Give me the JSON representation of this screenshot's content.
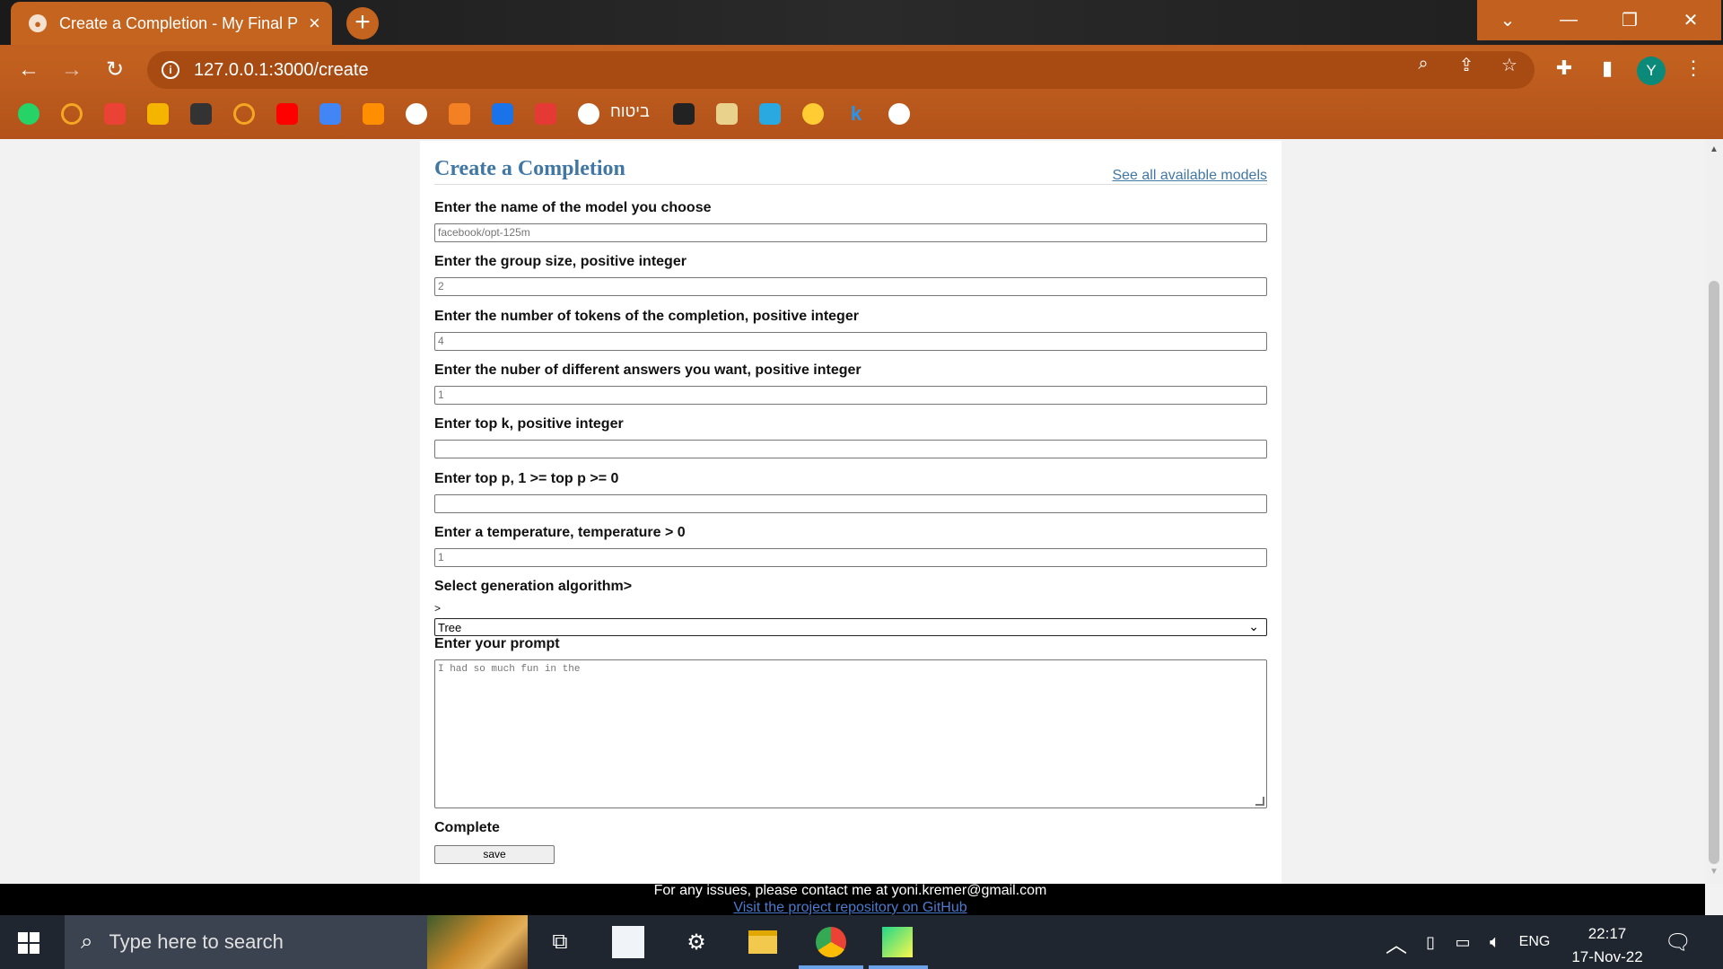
{
  "browser": {
    "tab_title": "Create a Completion - My Final P",
    "url": "127.0.0.1:3000/create",
    "profile_initial": "Y",
    "bookmark_label": "ביטוח"
  },
  "page": {
    "title": "Create a Completion",
    "models_link": "See all available models",
    "fields": {
      "model": {
        "label": "Enter the name of the model you choose",
        "placeholder": "facebook/opt-125m"
      },
      "group_size": {
        "label": "Enter the group size, positive integer",
        "placeholder": "2"
      },
      "tokens": {
        "label": "Enter the number of tokens of the completion, positive integer",
        "placeholder": "4"
      },
      "answers": {
        "label": "Enter the nuber of different answers you want, positive integer",
        "placeholder": "1"
      },
      "top_k": {
        "label": "Enter top k, positive integer",
        "placeholder": ""
      },
      "top_p": {
        "label": "Enter top p, 1 >= top p >= 0",
        "placeholder": ""
      },
      "temperature": {
        "label": "Enter a temperature, temperature > 0",
        "placeholder": "1"
      }
    },
    "algorithm": {
      "label": "Select generation algorithm>",
      "stray_text": ">",
      "selected": "Tree"
    },
    "prompt": {
      "label": "Enter your prompt",
      "placeholder": "I had so much fun in the"
    },
    "complete": {
      "label": "Complete",
      "button": "save"
    },
    "footer": {
      "contact": "For any issues, please contact me at yoni.kremer@gmail.com",
      "repo_link": "Visit the project repository on GitHub"
    }
  },
  "taskbar": {
    "search_placeholder": "Type here to search",
    "language": "ENG",
    "time": "22:17",
    "date": "17-Nov-22"
  },
  "colors": {
    "accent_title": "#4177a5",
    "chrome_orange": "#c2611f",
    "taskbar": "#1f2630"
  }
}
